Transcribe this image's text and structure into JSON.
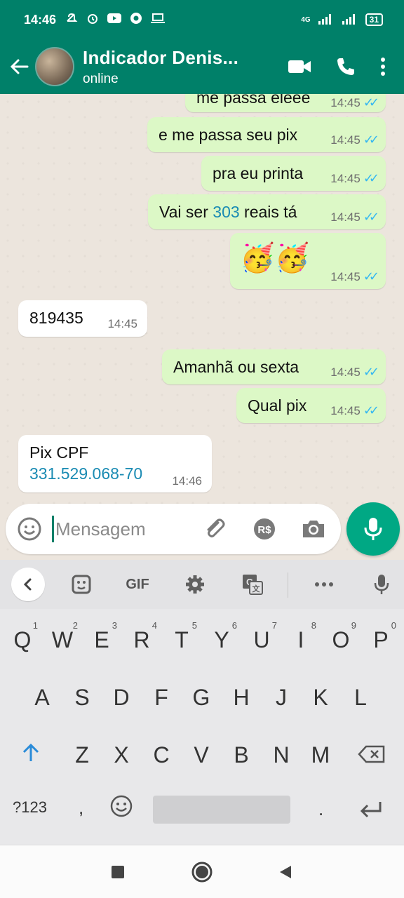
{
  "status_bar": {
    "time": "14:46",
    "battery": "31",
    "network": "4G"
  },
  "header": {
    "contact_name": "Indicador Denis...",
    "status": "online"
  },
  "messages": [
    {
      "direction": "out",
      "text": "me passa eleee",
      "time": "14:45",
      "read": true
    },
    {
      "direction": "out",
      "text": "e me passa seu pix",
      "time": "14:45",
      "read": true
    },
    {
      "direction": "out",
      "text": "pra eu printa",
      "time": "14:45",
      "read": true
    },
    {
      "direction": "out",
      "text_before": "Vai ser ",
      "text_highlight": "303",
      "text_after": " reais tá",
      "time": "14:45",
      "read": true
    },
    {
      "direction": "out",
      "emoji": "🥳🥳",
      "time": "14:45",
      "read": true
    },
    {
      "direction": "in",
      "text": "819435",
      "time": "14:45"
    },
    {
      "direction": "out",
      "text": "Amanhã ou sexta",
      "time": "14:45",
      "read": true
    },
    {
      "direction": "out",
      "text": "Qual pix",
      "time": "14:45",
      "read": true
    },
    {
      "direction": "in",
      "text": "Pix CPF",
      "text_link": "331.529.068-70",
      "time": "14:46"
    }
  ],
  "composer": {
    "placeholder": "Mensagem"
  },
  "keyboard": {
    "toolbar_gif": "GIF",
    "row1": [
      "Q",
      "W",
      "E",
      "R",
      "T",
      "Y",
      "U",
      "I",
      "O",
      "P"
    ],
    "row1_numbers": [
      "1",
      "2",
      "3",
      "4",
      "5",
      "6",
      "7",
      "8",
      "9",
      "0"
    ],
    "row2": [
      "A",
      "S",
      "D",
      "F",
      "G",
      "H",
      "J",
      "K",
      "L"
    ],
    "row3": [
      "Z",
      "X",
      "C",
      "V",
      "B",
      "N",
      "M"
    ],
    "symbols_key": "?123",
    "comma_key": ",",
    "period_key": "."
  },
  "colors": {
    "header": "#008069",
    "outgoing_bubble": "#dcf8c6",
    "incoming_bubble": "#ffffff",
    "read_ticks": "#34b7f1",
    "mic_button": "#00a884"
  }
}
